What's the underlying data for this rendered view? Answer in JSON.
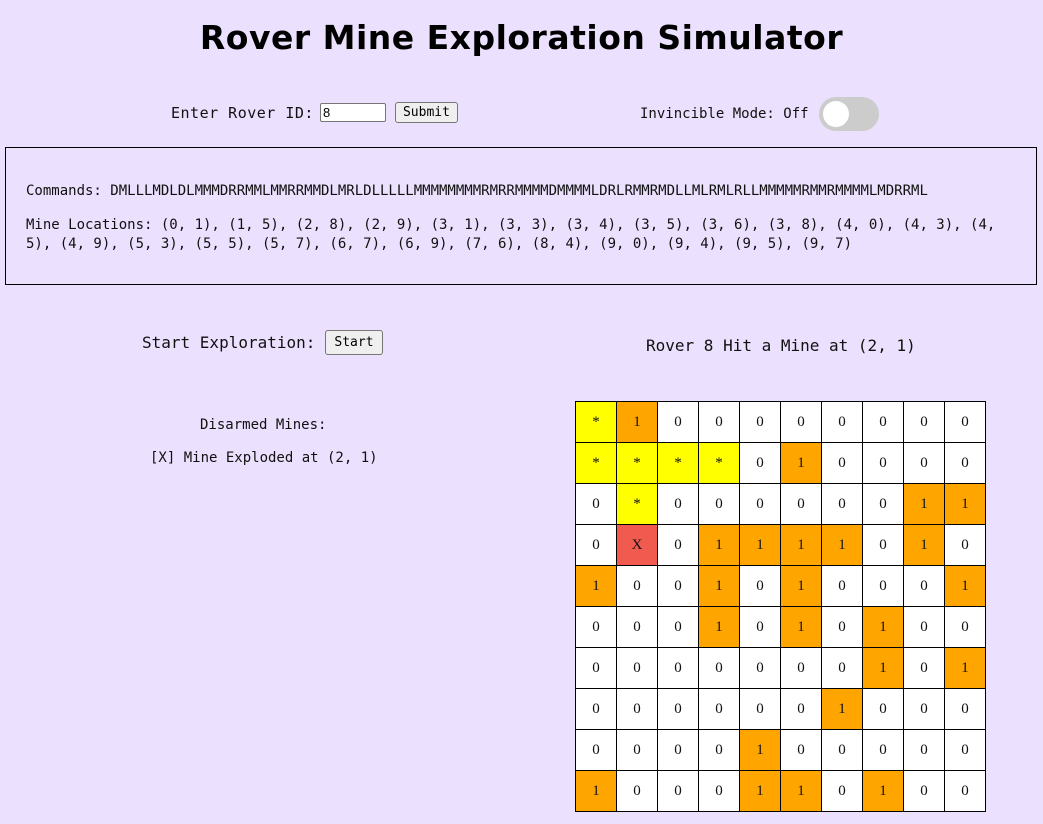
{
  "title": "Rover Mine Exploration Simulator",
  "rover_input": {
    "label": "Enter Rover ID:",
    "value": "8",
    "submit_label": "Submit"
  },
  "invincible": {
    "label": "Invincible Mode: Off",
    "state": "off"
  },
  "info": {
    "commands": "Commands: DMLLLMDLDLMMMDRRMMLMMRRMMDLMRLDLLLLLMMMMMMMMRMRRMMMMDMMMMLDRLRMMRMDLLMLRMLRLLMMMMMRMMRMMMMLMDRRML",
    "mine_locations": "Mine Locations: (0, 1), (1, 5), (2, 8), (2, 9), (3, 1), (3, 3), (3, 4), (3, 5), (3, 6), (3, 8), (4, 0), (4, 3), (4, 5), (4, 9), (5, 3), (5, 5), (5, 7), (6, 7), (6, 9), (7, 6), (8, 4), (9, 0), (9, 4), (9, 5), (9, 7)"
  },
  "exploration": {
    "start_label": "Start Exploration:",
    "start_button": "Start",
    "status": "Rover 8 Hit a Mine at (2, 1)"
  },
  "disarmed": {
    "title": "Disarmed Mines:",
    "items": [
      "[X] Mine Exploded at (2, 1)"
    ]
  },
  "colors": {
    "background": "#ebe0fd",
    "mine": "#ffa500",
    "path": "#ffff00",
    "hit": "#f15b4f"
  },
  "grid": [
    [
      {
        "t": "*",
        "s": "path"
      },
      {
        "t": "1",
        "s": "mine"
      },
      {
        "t": "0"
      },
      {
        "t": "0"
      },
      {
        "t": "0"
      },
      {
        "t": "0"
      },
      {
        "t": "0"
      },
      {
        "t": "0"
      },
      {
        "t": "0"
      },
      {
        "t": "0"
      }
    ],
    [
      {
        "t": "*",
        "s": "path"
      },
      {
        "t": "*",
        "s": "path"
      },
      {
        "t": "*",
        "s": "path"
      },
      {
        "t": "*",
        "s": "path"
      },
      {
        "t": "0"
      },
      {
        "t": "1",
        "s": "mine"
      },
      {
        "t": "0"
      },
      {
        "t": "0"
      },
      {
        "t": "0"
      },
      {
        "t": "0"
      }
    ],
    [
      {
        "t": "0"
      },
      {
        "t": "*",
        "s": "path"
      },
      {
        "t": "0"
      },
      {
        "t": "0"
      },
      {
        "t": "0"
      },
      {
        "t": "0"
      },
      {
        "t": "0"
      },
      {
        "t": "0"
      },
      {
        "t": "1",
        "s": "mine"
      },
      {
        "t": "1",
        "s": "mine"
      }
    ],
    [
      {
        "t": "0"
      },
      {
        "t": "X",
        "s": "hit"
      },
      {
        "t": "0"
      },
      {
        "t": "1",
        "s": "mine"
      },
      {
        "t": "1",
        "s": "mine"
      },
      {
        "t": "1",
        "s": "mine"
      },
      {
        "t": "1",
        "s": "mine"
      },
      {
        "t": "0"
      },
      {
        "t": "1",
        "s": "mine"
      },
      {
        "t": "0"
      }
    ],
    [
      {
        "t": "1",
        "s": "mine"
      },
      {
        "t": "0"
      },
      {
        "t": "0"
      },
      {
        "t": "1",
        "s": "mine"
      },
      {
        "t": "0"
      },
      {
        "t": "1",
        "s": "mine"
      },
      {
        "t": "0"
      },
      {
        "t": "0"
      },
      {
        "t": "0"
      },
      {
        "t": "1",
        "s": "mine"
      }
    ],
    [
      {
        "t": "0"
      },
      {
        "t": "0"
      },
      {
        "t": "0"
      },
      {
        "t": "1",
        "s": "mine"
      },
      {
        "t": "0"
      },
      {
        "t": "1",
        "s": "mine"
      },
      {
        "t": "0"
      },
      {
        "t": "1",
        "s": "mine"
      },
      {
        "t": "0"
      },
      {
        "t": "0"
      }
    ],
    [
      {
        "t": "0"
      },
      {
        "t": "0"
      },
      {
        "t": "0"
      },
      {
        "t": "0"
      },
      {
        "t": "0"
      },
      {
        "t": "0"
      },
      {
        "t": "0"
      },
      {
        "t": "1",
        "s": "mine"
      },
      {
        "t": "0"
      },
      {
        "t": "1",
        "s": "mine"
      }
    ],
    [
      {
        "t": "0"
      },
      {
        "t": "0"
      },
      {
        "t": "0"
      },
      {
        "t": "0"
      },
      {
        "t": "0"
      },
      {
        "t": "0"
      },
      {
        "t": "1",
        "s": "mine"
      },
      {
        "t": "0"
      },
      {
        "t": "0"
      },
      {
        "t": "0"
      }
    ],
    [
      {
        "t": "0"
      },
      {
        "t": "0"
      },
      {
        "t": "0"
      },
      {
        "t": "0"
      },
      {
        "t": "1",
        "s": "mine"
      },
      {
        "t": "0"
      },
      {
        "t": "0"
      },
      {
        "t": "0"
      },
      {
        "t": "0"
      },
      {
        "t": "0"
      }
    ],
    [
      {
        "t": "1",
        "s": "mine"
      },
      {
        "t": "0"
      },
      {
        "t": "0"
      },
      {
        "t": "0"
      },
      {
        "t": "1",
        "s": "mine"
      },
      {
        "t": "1",
        "s": "mine"
      },
      {
        "t": "0"
      },
      {
        "t": "1",
        "s": "mine"
      },
      {
        "t": "0"
      },
      {
        "t": "0"
      }
    ]
  ]
}
